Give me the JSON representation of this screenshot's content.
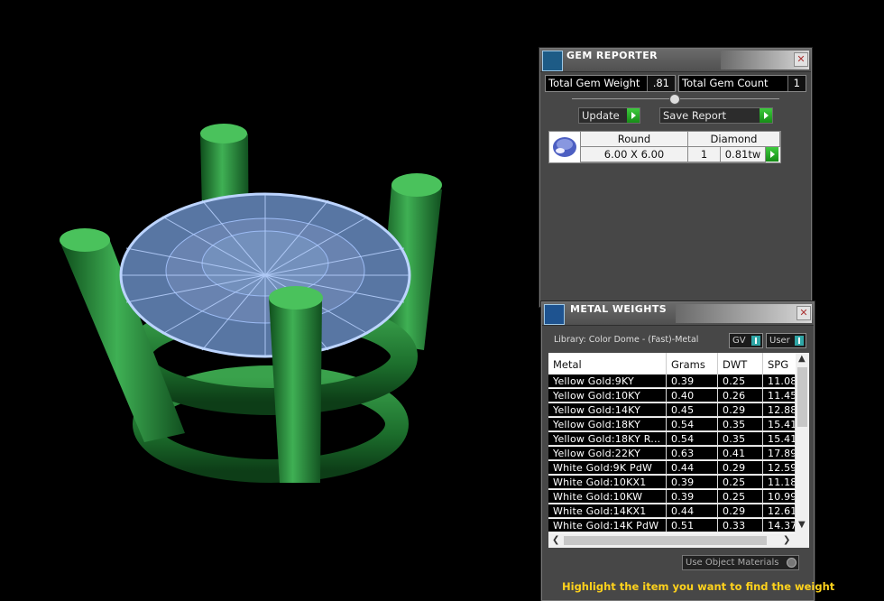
{
  "gem_reporter": {
    "title": "GEM REPORTER",
    "total_gem_weight_label": "Total Gem Weight",
    "total_gem_weight_value": ".81",
    "total_gem_count_label": "Total Gem Count",
    "total_gem_count_value": "1",
    "update_label": "Update",
    "save_report_label": "Save Report",
    "gem": {
      "shape": "Round",
      "material": "Diamond",
      "size": "6.00 X 6.00",
      "count": "1",
      "weight": "0.81tw"
    }
  },
  "metal_weights": {
    "title": "METAL WEIGHTS",
    "library": "Library: Color Dome - (Fast)-Metal",
    "gv_label": "GV",
    "user_label": "User",
    "columns": [
      "Metal",
      "Grams",
      "DWT",
      "SPG"
    ],
    "rows": [
      [
        "Yellow Gold:9KY",
        "0.39",
        "0.25",
        "11.08"
      ],
      [
        "Yellow Gold:10KY",
        "0.40",
        "0.26",
        "11.45"
      ],
      [
        "Yellow Gold:14KY",
        "0.45",
        "0.29",
        "12.88"
      ],
      [
        "Yellow Gold:18KY",
        "0.54",
        "0.35",
        "15.41"
      ],
      [
        "Yellow Gold:18KY R...",
        "0.54",
        "0.35",
        "15.41"
      ],
      [
        "Yellow Gold:22KY",
        "0.63",
        "0.41",
        "17.89"
      ],
      [
        "White Gold:9K PdW",
        "0.44",
        "0.29",
        "12.59"
      ],
      [
        "White Gold:10KX1",
        "0.39",
        "0.25",
        "11.18"
      ],
      [
        "White Gold:10KW",
        "0.39",
        "0.25",
        "10.99"
      ],
      [
        "White Gold:14KX1",
        "0.44",
        "0.29",
        "12.61"
      ],
      [
        "White Gold:14K PdW",
        "0.51",
        "0.33",
        "14.37"
      ]
    ],
    "use_object_materials": "Use Object Materials",
    "hint": "Highlight the item you want to find the weight"
  },
  "colors": {
    "panel_bg": "#474747",
    "play_green": "#2fb52f",
    "hint_yellow": "#ffd21c",
    "prong_green": "#2e9a3e",
    "gem_blue": "#8fb4ec"
  }
}
